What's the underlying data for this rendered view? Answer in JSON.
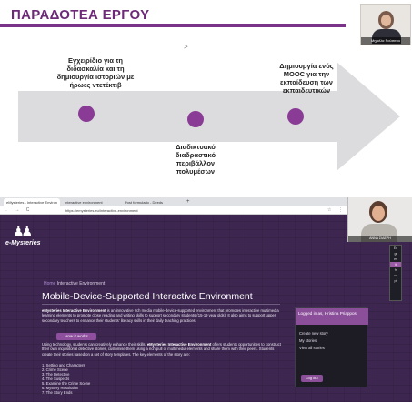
{
  "slide": {
    "title": "ΠΑΡΑΔΟΤΕΑ ΕΡΓΟΥ",
    "step1": "Εγχειρίδιο για τη διδασκαλία και τη δημιουργία ιστοριών με ήρωες ντετέκτιβ",
    "step2": "Διαδικτυακό διαδραστικό περιβάλλον πολυμέσων",
    "step3": "Δημιουργία ενός MOOC για την εκπαίδευση των εκπαιδευτικών",
    "cursor": ">",
    "presenter_name": "Μιχαέλα Ρούσσου"
  },
  "browser": {
    "tabs": [
      {
        "label": "eMysteries - Interactive Environ"
      },
      {
        "label": "Interactive environment"
      },
      {
        "label": "Post formulario - Deeds"
      }
    ],
    "new_tab": "+",
    "nav_icons": "← → C",
    "url": "https://emysteries.eu/interactive-environment",
    "addr_icons": "☆ ⋮"
  },
  "site": {
    "logo_text": "e-Mysteries",
    "logo_figs": "♟♟",
    "languages": [
      "En",
      "gr",
      "es",
      "it",
      "fr",
      "ro",
      "pt"
    ],
    "selected_language_index": 3,
    "breadcrumb_home": "Home",
    "breadcrumb_current": "Interactive Environment",
    "heading": "Mobile-Device-Supported Interactive Environment",
    "para1_bold": "eMysteries Interactive Environment",
    "para1": " is an innovative rich media mobile-device-supported environment that promotes interactive multimedia learning elements to promote close reading and writing skills to support secondary students (15-19 year olds). It also aims to support upper secondary teachers to enhance their students' literacy skills in their daily teaching practices.",
    "how_button": "How it works",
    "para2_a": "Using technology, students can creatively enhance their skills. ",
    "para2_bold": "eMysteries Interactive Environment",
    "para2_b": " offers students opportunities to construct their own inquisitorial detective stories, customise them using a rich pull of multimedia elements and share them with their peers. Students create their stories based on a set of story templates. The key elements of the story are:",
    "list": [
      "1. Setting and Characters",
      "2. Crime Scene",
      "3. The Detective",
      "4. The Suspects",
      "5. Examine the Crime Scene",
      "6. Mystery Resolution",
      "7. The Story Ends"
    ],
    "login_text": "Logged in as, Hristina Priappos",
    "login_links": [
      "Create new story",
      "My stories",
      "View all stories"
    ],
    "logout": "Log out",
    "presenter_name": "ΑΝΝΑ ΣΙΔΕΡΗ"
  }
}
